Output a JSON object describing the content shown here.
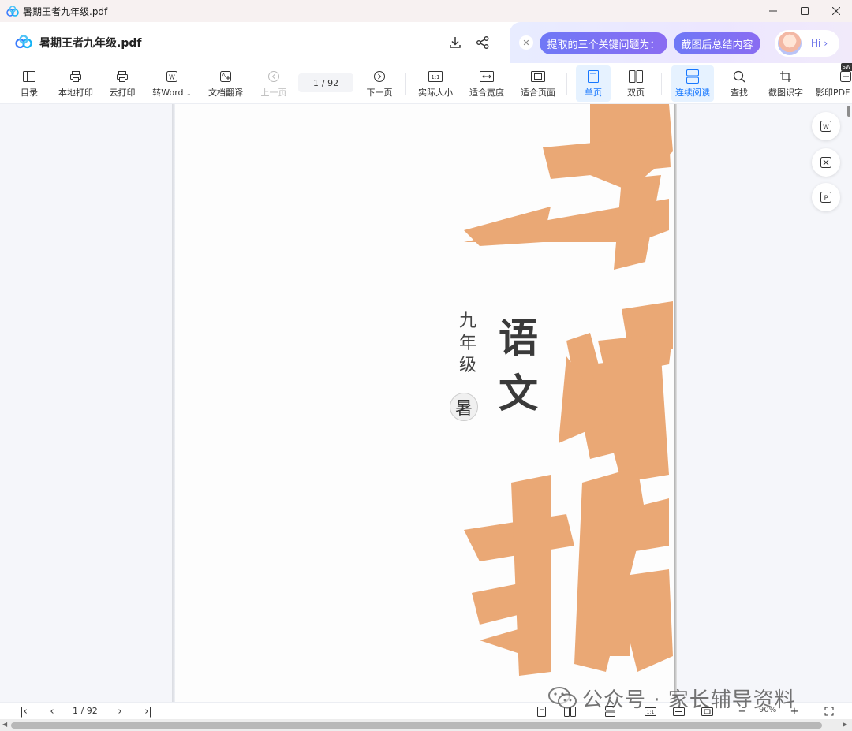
{
  "window": {
    "title": "暑期王者九年级.pdf",
    "controls": [
      "minimize",
      "maximize",
      "close"
    ]
  },
  "header": {
    "doc_name": "暑期王者九年级.pdf",
    "ai_chips": [
      "提取的三个关键问题为：",
      "截图后总结内容"
    ],
    "ai_greeting": "Hi"
  },
  "toolbar": {
    "items": {
      "toc": "目录",
      "local_print": "本地打印",
      "cloud_print": "云打印",
      "to_word": "转Word",
      "translate": "文档翻译",
      "prev_page": "上一页",
      "next_page": "下一页",
      "actual_size": "实际大小",
      "fit_width": "适合宽度",
      "fit_page": "适合页面",
      "single_page": "单页",
      "double_page": "双页",
      "continuous": "连续阅读",
      "find": "查找",
      "ocr": "截图识字",
      "scan_pdf": "影印PDF"
    },
    "actual_size_glyph": "1:1",
    "badge": "SW",
    "current_page": "1",
    "total_pages": "/ 92"
  },
  "cover": {
    "grade": "九年级",
    "subject": "语文",
    "seal": "暑"
  },
  "bottom_bar": {
    "current_page": "1",
    "total_pages": "/ 92",
    "zoom": "90%",
    "ratio_glyph": "1:1"
  },
  "watermark": {
    "text": "公众号 · 家长辅导资料"
  },
  "colors": {
    "accent": "#1677ff",
    "ai_chip": "#7a72f4",
    "brush": "#e9a16a",
    "notify_dot": "#ff4d6a"
  }
}
